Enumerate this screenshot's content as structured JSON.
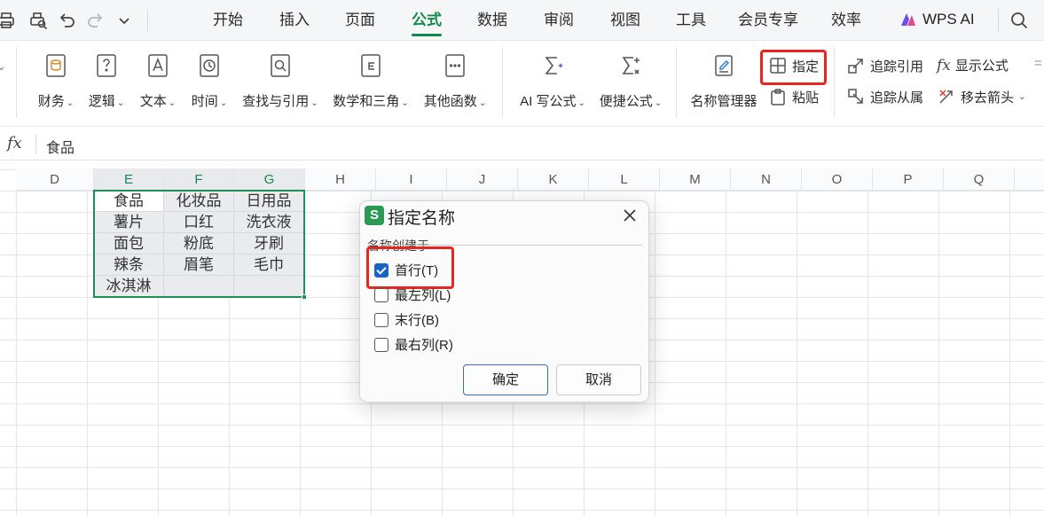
{
  "menubar": {
    "tabs": [
      "开始",
      "插入",
      "页面",
      "公式",
      "数据",
      "审阅",
      "视图",
      "工具",
      "会员专享",
      "效率"
    ],
    "active_tab": "公式",
    "wps_ai": "WPS AI"
  },
  "ribbon": {
    "groups": [
      "财务",
      "逻辑",
      "文本",
      "时间",
      "查找与引用",
      "数学和三角",
      "其他函数"
    ],
    "ai": [
      "AI 写公式",
      "便捷公式"
    ],
    "name_manager": "名称管理器",
    "specify": "指定",
    "paste": "粘贴",
    "trace_precedents": "追踪引用",
    "trace_dependents": "追踪从属",
    "show_formulas": "显示公式",
    "remove_arrows": "移去箭头"
  },
  "formula_bar": {
    "fx": "fx",
    "value": "食品"
  },
  "sheet": {
    "columns": [
      "D",
      "E",
      "F",
      "G",
      "H",
      "I",
      "J",
      "K",
      "L",
      "M",
      "N",
      "O",
      "P",
      "Q"
    ],
    "selected_columns": [
      "E",
      "F",
      "G"
    ],
    "cells": [
      [
        "食品",
        "化妆品",
        "日用品"
      ],
      [
        "薯片",
        "口红",
        "洗衣液"
      ],
      [
        "面包",
        "粉底",
        "牙刷"
      ],
      [
        "辣条",
        "眉笔",
        "毛巾"
      ],
      [
        "冰淇淋",
        "",
        ""
      ]
    ]
  },
  "dialog": {
    "title": "指定名称",
    "legend": "名称创建于",
    "options": [
      {
        "label": "首行(T)",
        "checked": true
      },
      {
        "label": "最左列(L)",
        "checked": false
      },
      {
        "label": "末行(B)",
        "checked": false
      },
      {
        "label": "最右列(R)",
        "checked": false
      }
    ],
    "ok": "确定",
    "cancel": "取消",
    "logo": "S"
  },
  "colors": {
    "accent": "#138a4a",
    "selection": "#1e8e57",
    "highlight": "#e8261f",
    "checkbox": "#1a63c7"
  }
}
